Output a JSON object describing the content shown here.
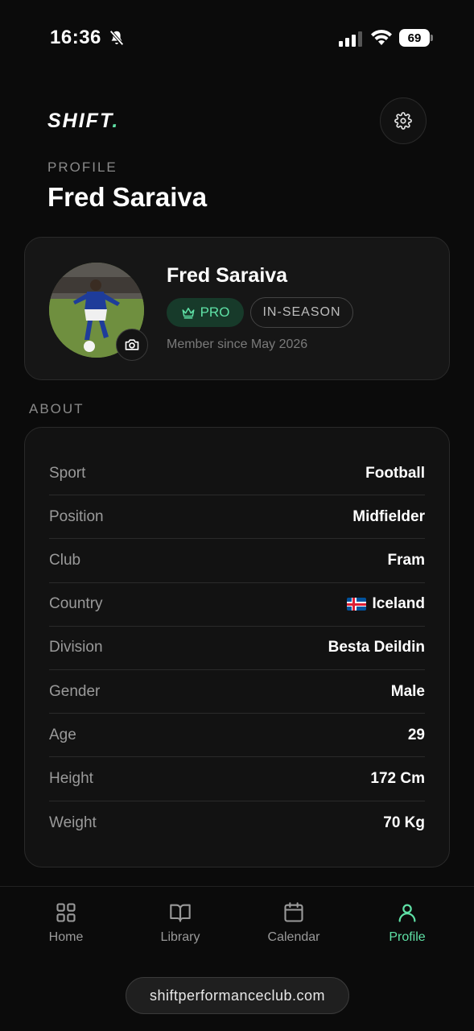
{
  "status_bar": {
    "time": "16:36",
    "battery_level": "69"
  },
  "header": {
    "logo_text": "SHIFT",
    "logo_dot": ".",
    "eyebrow": "PROFILE",
    "title": "Fred Saraiva",
    "settings_icon": "gear-icon"
  },
  "profile_card": {
    "name": "Fred Saraiva",
    "badge_pro": "PRO",
    "badge_season": "IN-SEASON",
    "member_since": "Member since May 2026"
  },
  "about": {
    "label": "ABOUT",
    "rows": [
      {
        "key": "Sport",
        "value": "Football"
      },
      {
        "key": "Position",
        "value": "Midfielder"
      },
      {
        "key": "Club",
        "value": "Fram"
      },
      {
        "key": "Country",
        "value": "Iceland"
      },
      {
        "key": "Division",
        "value": "Besta Deildin"
      },
      {
        "key": "Gender",
        "value": "Male"
      },
      {
        "key": "Age",
        "value": "29"
      },
      {
        "key": "Height",
        "value": "172 Cm"
      },
      {
        "key": "Weight",
        "value": "70 Kg"
      }
    ]
  },
  "nav": {
    "items": [
      {
        "label": "Home",
        "icon": "home-grid-icon"
      },
      {
        "label": "Library",
        "icon": "book-icon"
      },
      {
        "label": "Calendar",
        "icon": "calendar-icon"
      },
      {
        "label": "Profile",
        "icon": "user-icon"
      }
    ],
    "active": "Profile"
  },
  "browser": {
    "url": "shiftperformanceclub.com"
  },
  "colors": {
    "accent": "#5fe1a6",
    "background": "#0b0b0b",
    "card": "#161616"
  }
}
